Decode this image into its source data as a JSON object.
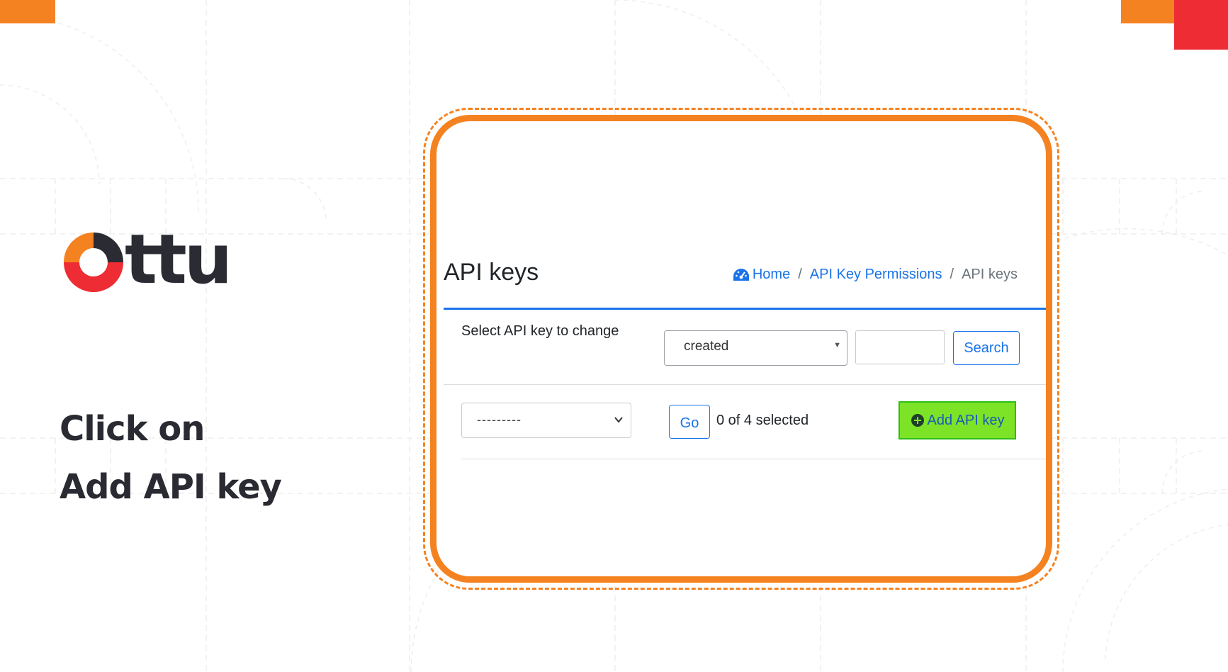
{
  "brand": {
    "name": "ttu",
    "colors": {
      "orange": "#f58220",
      "red": "#ed2c33",
      "dark": "#2b2b33"
    }
  },
  "caption": {
    "line1": "Click on",
    "line2": "Add API key"
  },
  "admin": {
    "title": "API keys",
    "breadcrumb": {
      "home": "Home",
      "section": "API Key Permissions",
      "current": "API keys",
      "separator": "/",
      "home_icon": "dashboard-icon"
    },
    "filter": {
      "label": "Select API key to change",
      "sort_value": "created",
      "search_value": "",
      "search_button": "Search"
    },
    "actions": {
      "action_value": "---------",
      "go_button": "Go",
      "selected_text": "0 of 4 selected",
      "add_button": "Add API key",
      "add_icon": "plus-circle-icon"
    },
    "colors": {
      "link": "#1a73e8",
      "highlight": "#7ce327"
    }
  }
}
